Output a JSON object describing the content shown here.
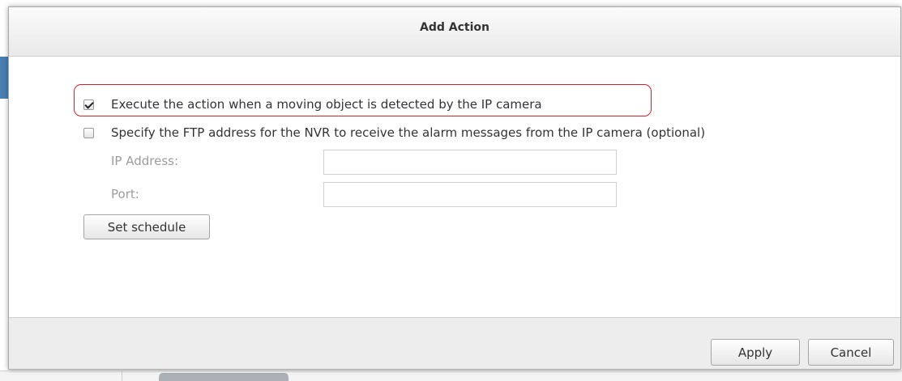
{
  "dialog": {
    "title": "Add Action",
    "options": [
      {
        "label": "Execute the action when a moving object is detected by the IP camera",
        "checked": true
      },
      {
        "label": "Specify the FTP address for the NVR to receive the alarm messages from the IP camera (optional)",
        "checked": false
      }
    ],
    "fields": {
      "ip_label": "IP Address:",
      "ip_value": "",
      "port_label": "Port:",
      "port_value": ""
    },
    "set_schedule_label": "Set schedule",
    "apply_label": "Apply",
    "cancel_label": "Cancel"
  },
  "colors": {
    "highlight": "#d2232a",
    "footer": "#ededed"
  }
}
